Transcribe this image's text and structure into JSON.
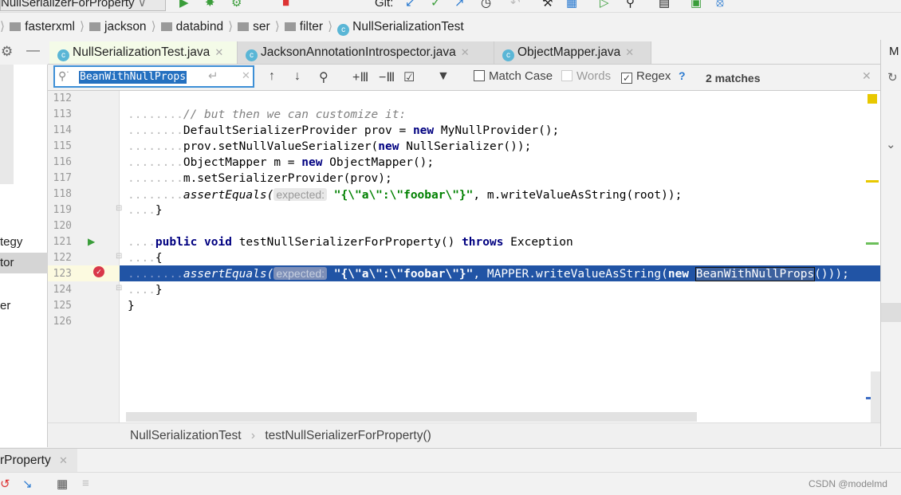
{
  "toolbar": {
    "run_config": "NullSerializerForProperty",
    "git_label": "Git:"
  },
  "breadcrumbs": [
    "fasterxml",
    "jackson",
    "databind",
    "ser",
    "filter",
    "NullSerializationTest"
  ],
  "tabs": [
    {
      "label": "NullSerializationTest.java",
      "active": true
    },
    {
      "label": "JacksonAnnotationIntrospector.java"
    },
    {
      "label": "ObjectMapper.java"
    }
  ],
  "right_tab": "M",
  "find": {
    "query": "BeanWithNullProps",
    "match_case": "Match Case",
    "words": "Words",
    "regex": "Regex",
    "help": "?",
    "matches": "2 matches",
    "match_case_checked": false,
    "words_checked": false,
    "regex_checked": true
  },
  "left_panel": [
    "tegy",
    "tor",
    "er"
  ],
  "editor": {
    "line_numbers": [
      "112",
      "113",
      "114",
      "115",
      "116",
      "117",
      "118",
      "119",
      "120",
      "121",
      "122",
      "123",
      "124",
      "125",
      "126"
    ],
    "lines": {
      "l113": "// but then we can customize it:",
      "l114a": "DefaultSerializerProvider prov = ",
      "l114kw": "new",
      "l114b": " MyNullProvider();",
      "l115a": "prov.setNullValueSerializer(",
      "l115kw": "new",
      "l115b": " NullSerializer());",
      "l116a": "ObjectMapper m = ",
      "l116kw": "new",
      "l116b": " ObjectMapper();",
      "l117": "m.setSerializerProvider(prov);",
      "l118a": "assertEquals(",
      "hint": "expected:",
      "str": "\"{\\\"a\\\":\\\"foobar\\\"}\"",
      "l118b": ", m.writeValueAsString(root));",
      "brace_close": "}",
      "l121kw1": "public",
      "l121kw2": "void",
      "l121a": " testNullSerializerForProperty() ",
      "l121kw3": "throws",
      "l121b": " Exception",
      "brace_open": "{",
      "l123a": "assertEquals(",
      "l123b": ", MAPPER.writeValueAsString(",
      "l123kw": "new",
      "l123match": "BeanWithNullProps",
      "l123c": "()));"
    }
  },
  "nav_crumbs": [
    "NullSerializationTest",
    "testNullSerializerForProperty()"
  ],
  "bottom_tab": "rProperty",
  "watermark": "CSDN @modelmd",
  "colors": {
    "selection": "#2154a5",
    "keyword": "#000080",
    "string": "#008000",
    "accent": "#3d8fd6"
  }
}
